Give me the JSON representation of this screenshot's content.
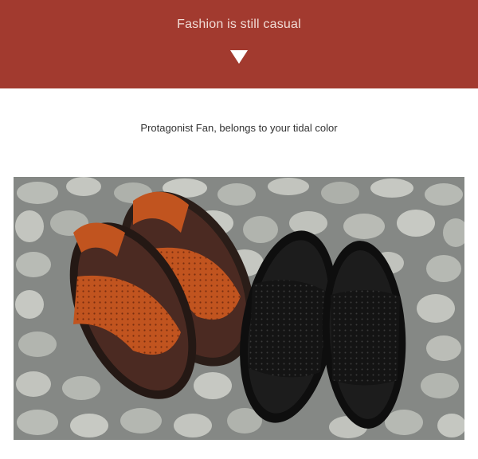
{
  "banner": {
    "title": "Fashion is still casual",
    "background_color": "#a23a2f",
    "arrow_icon": "down-triangle-icon"
  },
  "subtitle": "Protagonist Fan, belongs to your tidal color",
  "photo": {
    "left_pair_color": "#c1541f",
    "right_pair_color": "#141414",
    "ground": "cobblestone"
  }
}
